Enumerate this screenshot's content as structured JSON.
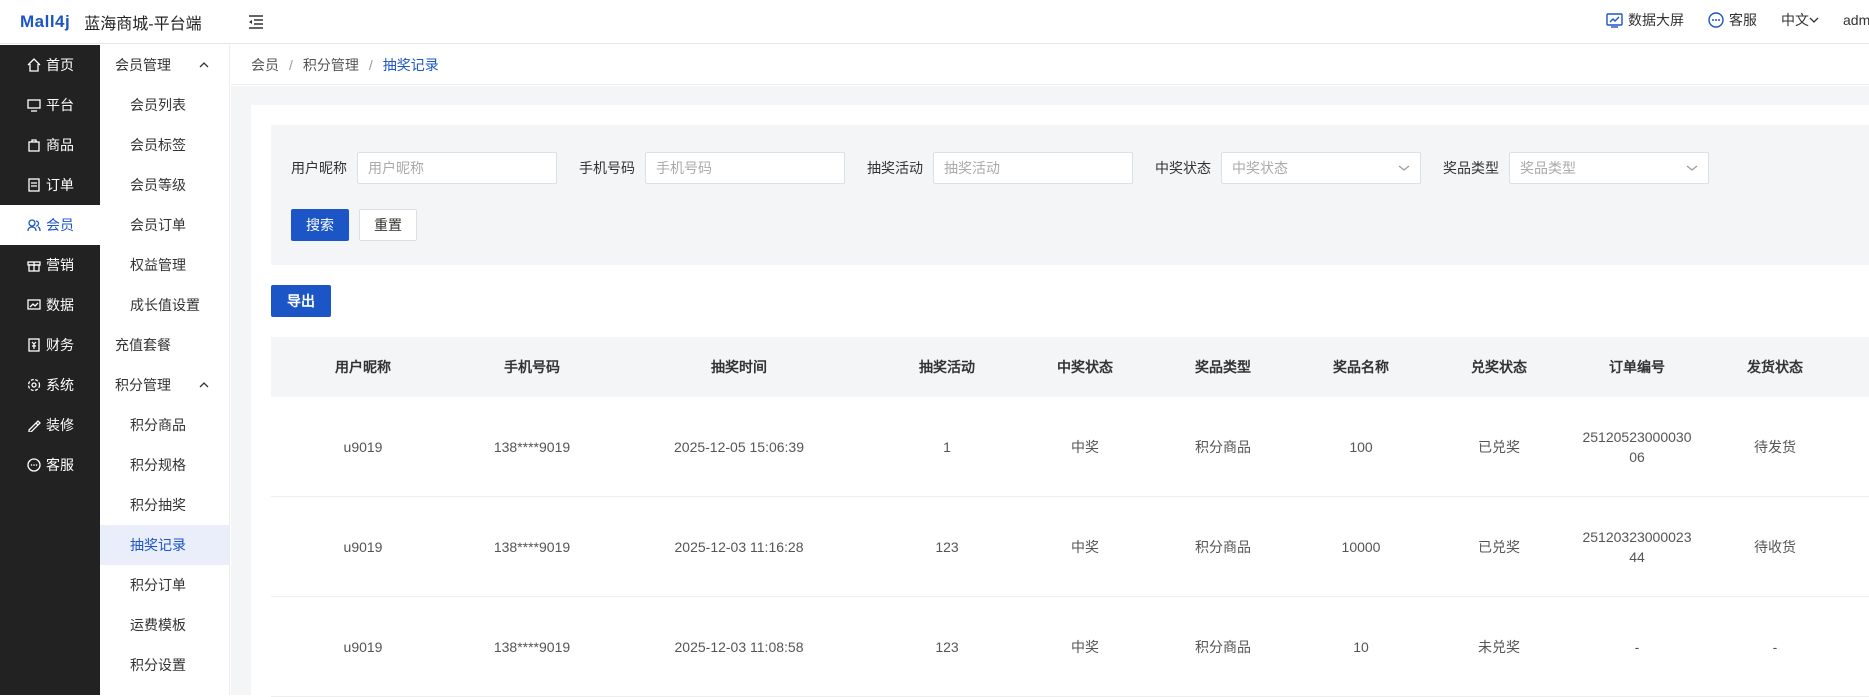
{
  "header": {
    "logo": "Mall4j",
    "title": "蓝海商城-平台端",
    "data_screen": "数据大屏",
    "service": "客服",
    "language": "中文",
    "user": "admin"
  },
  "primary_nav": [
    {
      "label": "首页",
      "icon": "home-icon"
    },
    {
      "label": "平台",
      "icon": "monitor-icon"
    },
    {
      "label": "商品",
      "icon": "bag-icon"
    },
    {
      "label": "订单",
      "icon": "order-icon"
    },
    {
      "label": "会员",
      "icon": "users-icon",
      "active": true
    },
    {
      "label": "营销",
      "icon": "gift-icon"
    },
    {
      "label": "数据",
      "icon": "chart-icon"
    },
    {
      "label": "财务",
      "icon": "finance-icon"
    },
    {
      "label": "系统",
      "icon": "gear-icon"
    },
    {
      "label": "装修",
      "icon": "decorate-icon"
    },
    {
      "label": "客服",
      "icon": "chat-icon"
    }
  ],
  "secondary_nav": {
    "group1": "会员管理",
    "group1_items": [
      "会员列表",
      "会员标签",
      "会员等级",
      "会员订单",
      "权益管理",
      "成长值设置"
    ],
    "single": "充值套餐",
    "group2": "积分管理",
    "group2_items": [
      "积分商品",
      "积分规格",
      "积分抽奖",
      "抽奖记录",
      "积分订单",
      "运费模板",
      "积分设置"
    ]
  },
  "breadcrumb": [
    "会员",
    "积分管理",
    "抽奖记录"
  ],
  "search": {
    "fields": [
      {
        "label": "用户昵称",
        "placeholder": "用户昵称"
      },
      {
        "label": "手机号码",
        "placeholder": "手机号码"
      },
      {
        "label": "抽奖活动",
        "placeholder": "抽奖活动"
      },
      {
        "label": "中奖状态",
        "placeholder": "中奖状态"
      },
      {
        "label": "奖品类型",
        "placeholder": "奖品类型"
      }
    ],
    "search_btn": "搜索",
    "reset_btn": "重置"
  },
  "export_btn": "导出",
  "table": {
    "columns": [
      "用户昵称",
      "手机号码",
      "抽奖时间",
      "抽奖活动",
      "中奖状态",
      "奖品类型",
      "奖品名称",
      "兑奖状态",
      "订单编号",
      "发货状态"
    ],
    "rows": [
      [
        "u9019",
        "138****9019",
        "2025-12-05 15:06:39",
        "1",
        "中奖",
        "积分商品",
        "100",
        "已兑奖",
        "2512052300003006",
        "待发货"
      ],
      [
        "u9019",
        "138****9019",
        "2025-12-03 11:16:28",
        "123",
        "中奖",
        "积分商品",
        "10000",
        "已兑奖",
        "2512032300002344",
        "待收货"
      ],
      [
        "u9019",
        "138****9019",
        "2025-12-03 11:08:58",
        "123",
        "中奖",
        "积分商品",
        "10",
        "未兑奖",
        "-",
        "-"
      ]
    ]
  },
  "colors": {
    "accent": "#1b55c6",
    "sidebar": "#222222"
  }
}
